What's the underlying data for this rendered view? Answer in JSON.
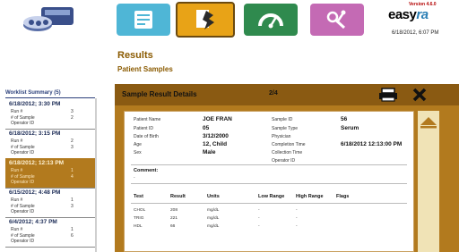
{
  "header": {
    "version": "Version 4.6.0",
    "brand_main": "easy",
    "brand_accent": "ra",
    "datetime": "6/18/2012, 6:07 PM",
    "nav": [
      "results-icon",
      "analyze-icon",
      "gauge-icon",
      "tools-icon"
    ]
  },
  "page": {
    "title": "Results",
    "subtitle": "Patient Samples"
  },
  "worklist": {
    "title": "Worklist Summary  (5)",
    "row_labels": [
      "Run #",
      "# of Sample",
      "Operator ID"
    ],
    "items": [
      {
        "date": "6/18/2012; 3:30 PM",
        "run": "3",
        "samples": "2",
        "selected": false
      },
      {
        "date": "6/18/2012; 3:15 PM",
        "run": "2",
        "samples": "3",
        "selected": false
      },
      {
        "date": "6/18/2012; 12:13 PM",
        "run": "1",
        "samples": "4",
        "selected": true
      },
      {
        "date": "6/15/2012; 4:48 PM",
        "run": "1",
        "samples": "3",
        "selected": false
      },
      {
        "date": "6/4/2012; 4:37 PM",
        "run": "1",
        "samples": "6",
        "selected": false
      }
    ]
  },
  "panel": {
    "title": "Sample Result Details",
    "page": "2/4",
    "patient": {
      "name_label": "Patient Name",
      "name": "JOE  FRAN",
      "id_label": "Patient ID",
      "id": "05",
      "dob_label": "Date of Birth",
      "dob": "3/12/2000",
      "age_label": "Age",
      "age": "12,  Child",
      "sex_label": "Sex",
      "sex": "Male"
    },
    "sample": {
      "id_label": "Sample ID",
      "id": "56",
      "type_label": "Sample Type",
      "type": "Serum",
      "physician_label": "Physician",
      "physician": "",
      "completion_label": "Completion Time",
      "completion": "6/18/2012 12:13:00 PM",
      "collection_label": "Collection Time",
      "collection": "",
      "operator_label": "Operator ID",
      "operator": ""
    },
    "comment_label": "Comment:",
    "comment": "-",
    "table": {
      "headers": [
        "Test",
        "Result",
        "Units",
        "Low Range",
        "High Range",
        "Flags"
      ],
      "rows": [
        [
          "CHOL",
          "208",
          "mg/dL",
          "-",
          "-",
          ""
        ],
        [
          "TRIG",
          "221",
          "mg/dL",
          "-",
          "-",
          ""
        ],
        [
          "HDL",
          "66",
          "mg/dL",
          "-",
          "-",
          ""
        ]
      ]
    }
  },
  "colors": {
    "accent_gold": "#b27a1e",
    "header_dark": "#8a5a12",
    "title_brown": "#8a5a00",
    "nav_results": "#4fb6d6",
    "nav_analyze": "#e8a317",
    "nav_gauge": "#2f8a4e",
    "nav_tools": "#c46ab4"
  }
}
